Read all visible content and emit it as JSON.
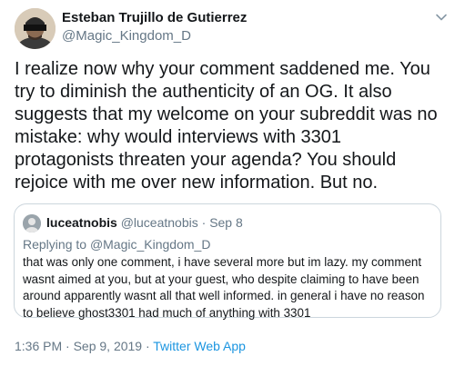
{
  "tweet": {
    "display_name": "Esteban Trujillo de Gutierrez",
    "handle": "@Magic_Kingdom_D",
    "text": "I realize now why your comment saddened me. You try to diminish the authenticity of an OG. It also suggests that my welcome on your subreddit was no mistake: why would interviews with 3301 protagonists threaten your agenda? You should rejoice with me over new information. But no."
  },
  "quoted": {
    "display_name": "luceatnobis",
    "handle": "@luceatnobis",
    "separator": "·",
    "date": "Sep 8",
    "replying_label": "Replying to",
    "replying_to": "@Magic_Kingdom_D",
    "text": "that was only one comment, i have several more but im lazy. my comment wasnt aimed at you, but at your guest, who despite claiming to have been around apparently wasnt all that well informed. in general i have no reason to believe ghost3301 had much of anything with 3301"
  },
  "meta": {
    "timestamp": "1:36 PM · Sep 9, 2019 ·",
    "source": "Twitter Web App"
  },
  "icons": {
    "caret": "chevron-down-icon",
    "avatar": "user-avatar",
    "quoted_avatar": "user-avatar"
  },
  "colors": {
    "text": "#14171a",
    "secondary": "#657786",
    "link": "#1b95e0",
    "border": "#ccd6dd"
  }
}
